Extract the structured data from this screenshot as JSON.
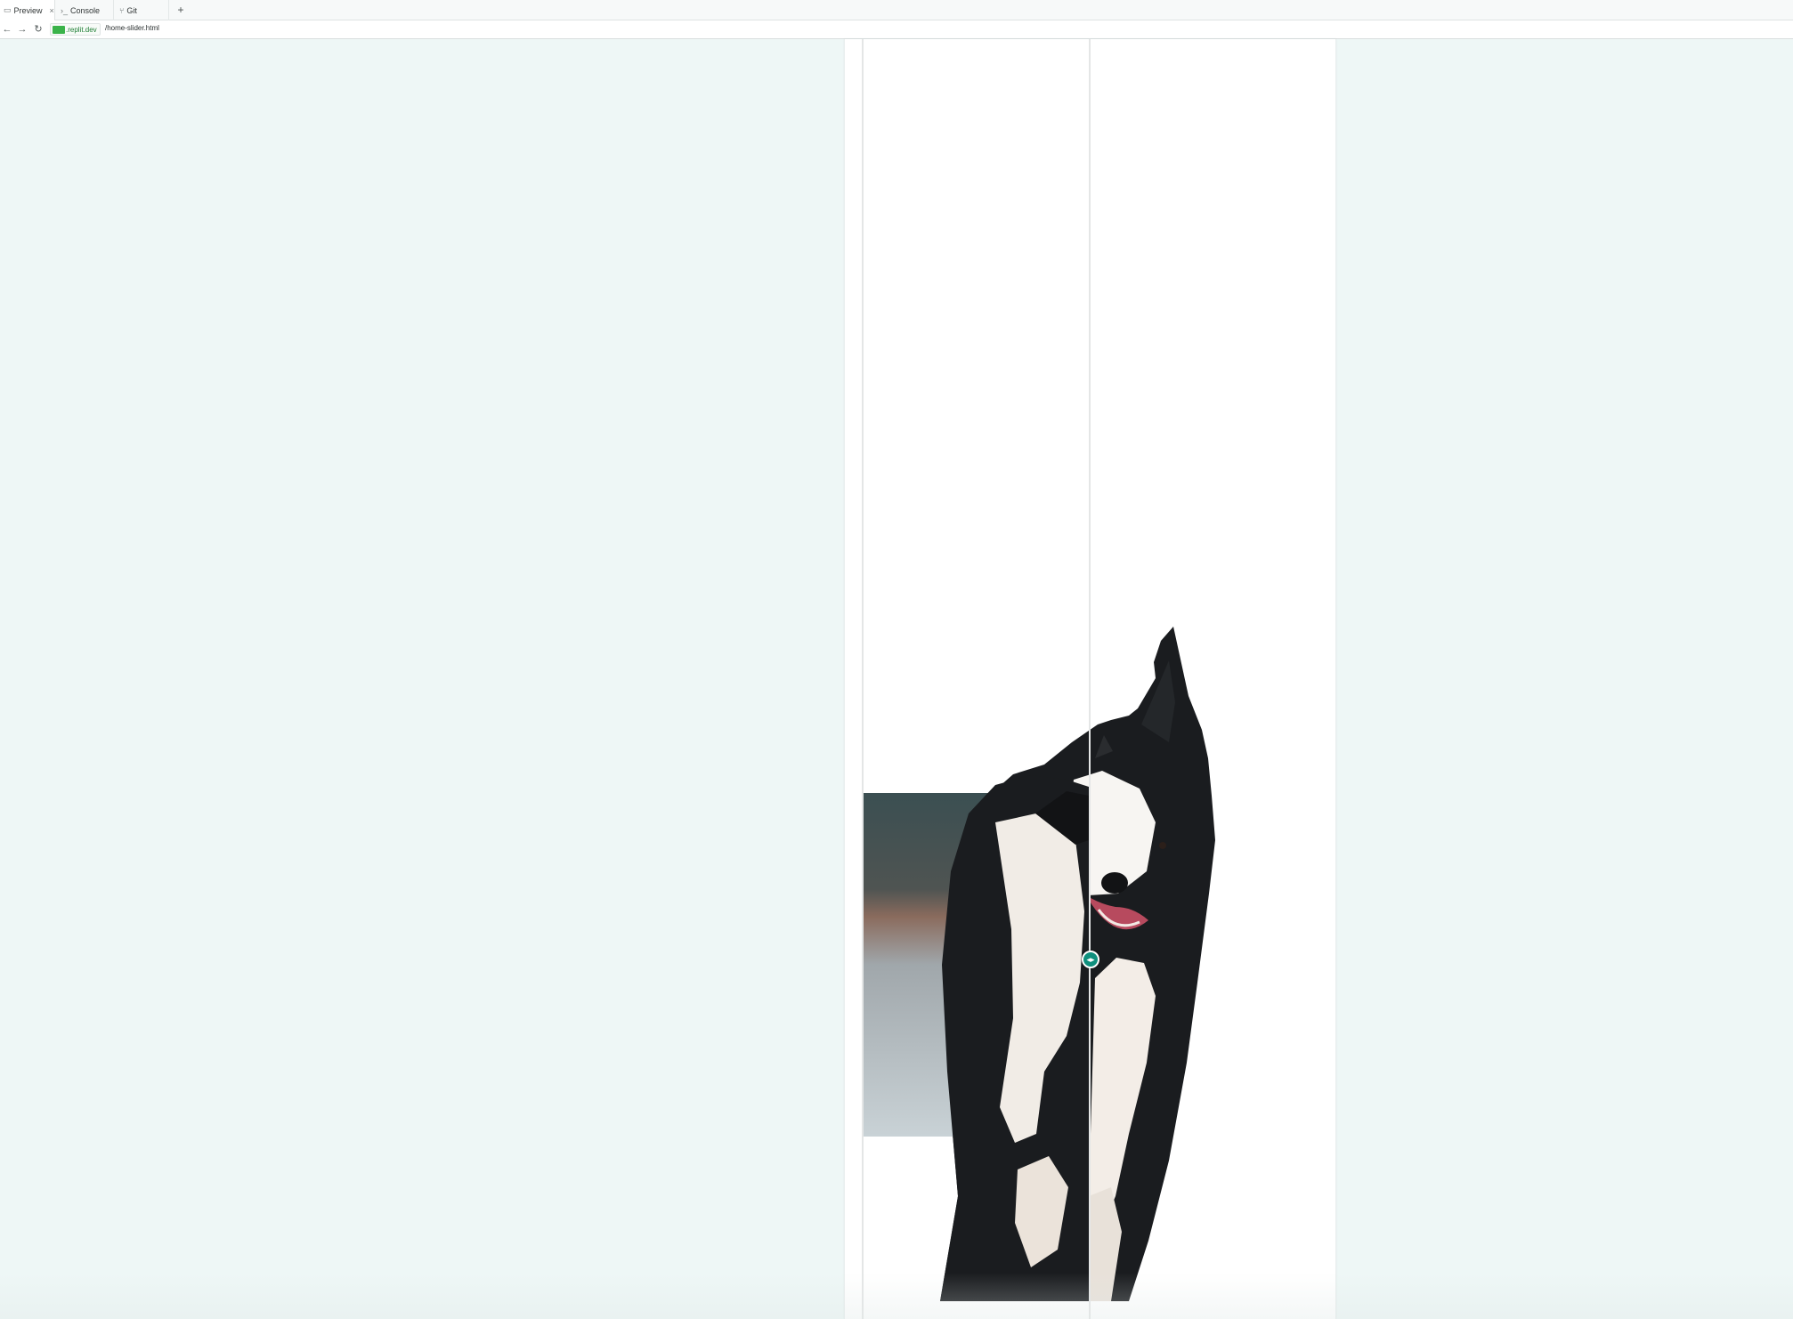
{
  "tabs": [
    {
      "label": "Preview",
      "icon": "monitor-icon",
      "active": true,
      "close": "×"
    },
    {
      "label": "Console",
      "icon": "terminal-icon",
      "active": false
    },
    {
      "label": "Git",
      "icon": "git-branch-icon",
      "active": false
    }
  ],
  "add_tab": "+",
  "nav": {
    "back": "←",
    "forward": "→",
    "reload": "↻"
  },
  "address": {
    "domain": ".replit.dev",
    "path": "/home-slider.html"
  },
  "slider": {
    "position_percent": 50,
    "handle_glyph": "◂▸",
    "left_image": "dog photo with background (before)",
    "right_image": "dog cutout with background removed (after)"
  },
  "colors": {
    "page_bg": "#eef7f6",
    "accent": "#0f8f7d",
    "domain_badge": "#3bb34a"
  }
}
